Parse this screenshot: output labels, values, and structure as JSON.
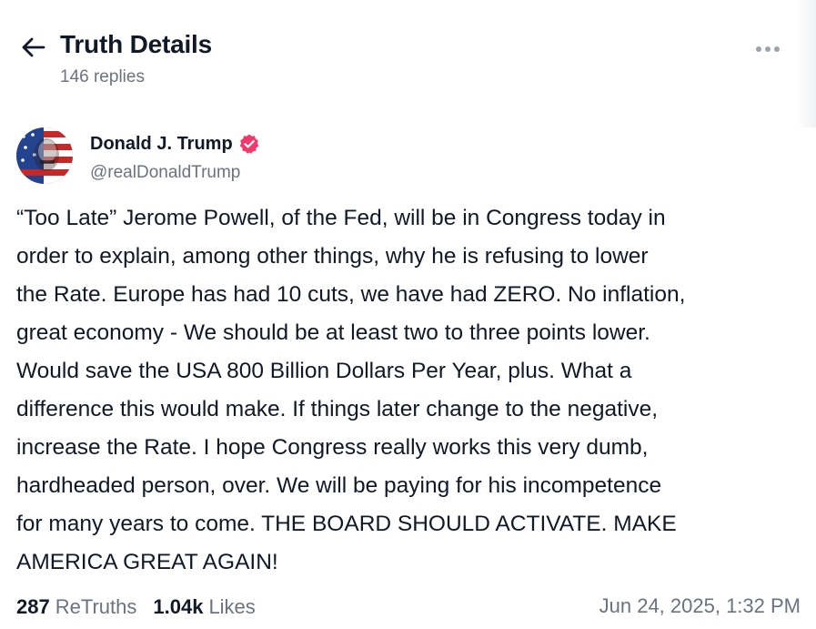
{
  "header": {
    "title": "Truth Details",
    "reply_count": "146 replies",
    "back_icon": "arrow-left-icon",
    "more_icon": "ellipsis-horizontal-icon"
  },
  "post": {
    "author_name": "Donald J. Trump",
    "handle": "@realDonaldTrump",
    "verified_icon": "verified-badge-icon",
    "verified_color": "#f4366a",
    "lines": [
      "“Too Late” Jerome Powell, of the Fed, will be in Congress today in",
      "order to explain, among other things, why he is refusing to lower",
      "the Rate. Europe has had 10 cuts, we have had ZERO. No inflation,",
      "great economy - We should be at least two to three points lower.",
      "Would save the USA 800 Billion Dollars Per Year, plus. What a",
      "difference this would make. If things later change to the negative,",
      "increase the Rate. I hope Congress really works this very dumb,",
      "hardheaded person, over. We will be paying for his incompetence",
      "for many years to come. THE BOARD SHOULD ACTIVATE. MAKE",
      "AMERICA GREAT AGAIN!"
    ]
  },
  "stats": {
    "retruths_count": "287",
    "retruths_label": "ReTruths",
    "likes_count": "1.04k",
    "likes_label": "Likes",
    "timestamp": "Jun 24, 2025, 1:32 PM"
  }
}
